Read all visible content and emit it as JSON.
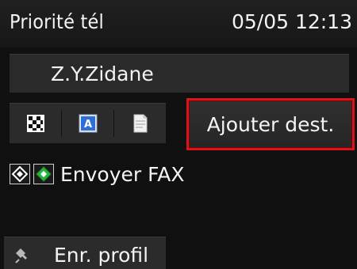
{
  "status_bar": {
    "title": "Priorité tél",
    "datetime": "05/05 12:13"
  },
  "recipient": {
    "name": "Z.Y.Zidane"
  },
  "scan_settings": {
    "buttons": [
      {
        "icon": "resolution-checker-icon"
      },
      {
        "icon": "text-document-icon"
      },
      {
        "icon": "page-document-icon"
      }
    ]
  },
  "add_recipient": {
    "label": "Ajouter dest.",
    "highlight_color": "#d8141a"
  },
  "send_fax": {
    "label": "Envoyer FAX",
    "icons": [
      "monochrome-start-icon",
      "color-start-icon"
    ],
    "start_color": "#26b43c"
  },
  "save_profile": {
    "label": "Enr. profil",
    "icon": "pin-icon"
  }
}
